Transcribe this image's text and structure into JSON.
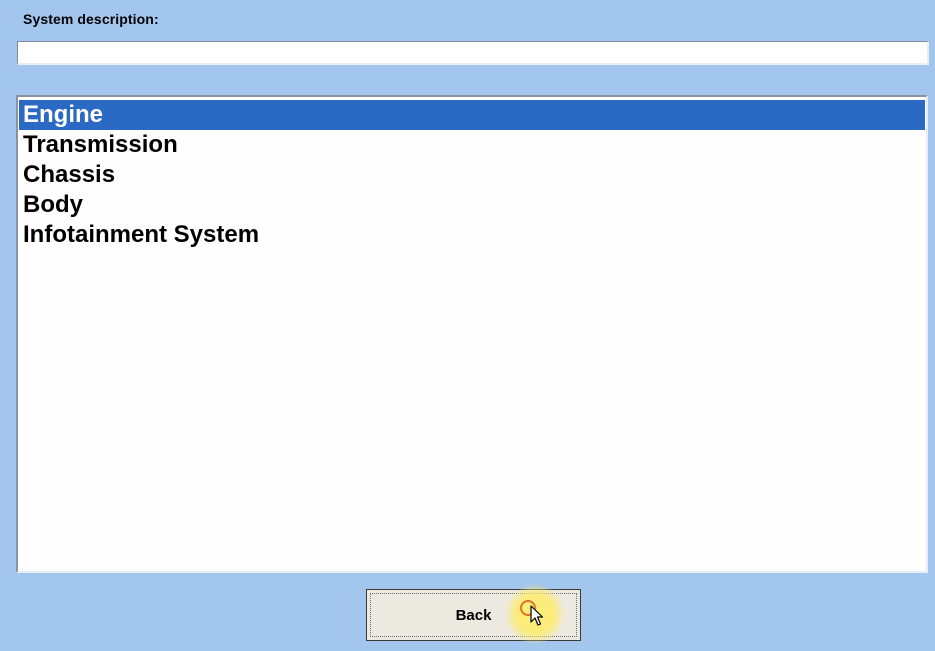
{
  "form": {
    "system_description_label": "System description:",
    "system_description_value": ""
  },
  "systems_list": {
    "selected_index": 0,
    "items": [
      {
        "label": "Engine"
      },
      {
        "label": "Transmission"
      },
      {
        "label": "Chassis"
      },
      {
        "label": "Body"
      },
      {
        "label": "Infotainment System"
      }
    ]
  },
  "buttons": {
    "back_label": "Back"
  },
  "colors": {
    "background": "#a3c6ef",
    "selection": "#2a69c4",
    "list_background": "#fefefe",
    "button_face": "#ece9e1",
    "cursor_highlight": "#ffec64",
    "cursor_ring": "#e0722a"
  },
  "icons": {
    "mouse_pointer": "arrow-pointer-icon"
  }
}
